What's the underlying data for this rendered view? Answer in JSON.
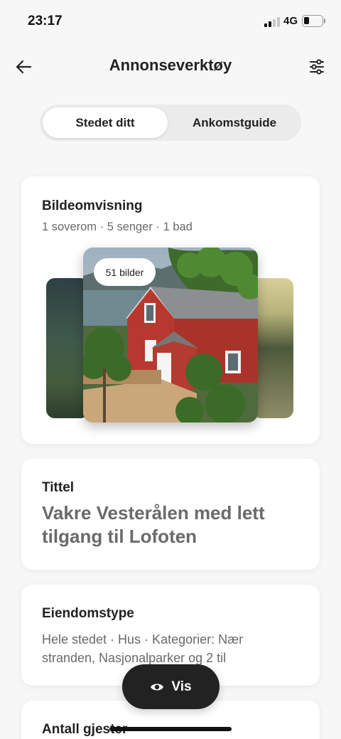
{
  "status_bar": {
    "time": "23:17",
    "network": "4G"
  },
  "header": {
    "title": "Annonseverktøy"
  },
  "tabs": [
    {
      "label": "Stedet ditt",
      "active": true
    },
    {
      "label": "Ankomstguide",
      "active": false
    }
  ],
  "photo_card": {
    "heading": "Bildeomvisning",
    "subtitle": "1 soverom  ·  5 senger  ·  1 bad",
    "badge": "51 bilder"
  },
  "title_card": {
    "heading": "Tittel",
    "value": "Vakre Vesterålen med lett tilgang til Lofoten"
  },
  "type_card": {
    "heading": "Eiendomstype",
    "value": "Hele stedet · Hus · Kategorier: Nær stranden, Nasjonalparker og 2 til"
  },
  "guests_card": {
    "heading": "Antall gjester"
  },
  "floating_button": {
    "label": "Vis"
  },
  "colors": {
    "primary_text": "#222222",
    "secondary_text": "#6a6a6a",
    "button_bg": "#222222",
    "background": "#f7f7f7"
  },
  "icons": {
    "back": "arrow-left-icon",
    "filter": "sliders-icon",
    "eye": "eye-icon"
  }
}
